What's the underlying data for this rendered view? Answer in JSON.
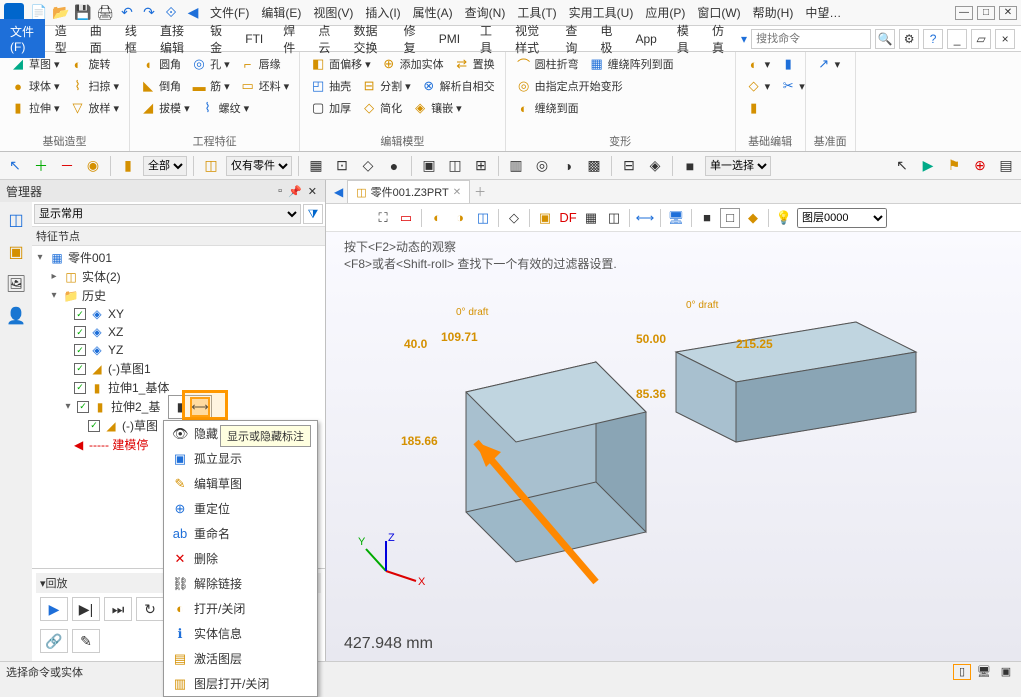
{
  "menus": [
    "文件(F)",
    "编辑(E)",
    "视图(V)",
    "插入(I)",
    "属性(A)",
    "查询(N)",
    "工具(T)",
    "实用工具(U)",
    "应用(P)",
    "窗口(W)",
    "帮助(H)",
    "中望…"
  ],
  "ribbon_tabs": [
    "文件(F)",
    "造型",
    "曲面",
    "线框",
    "直接编辑",
    "钣金",
    "FTI",
    "焊件",
    "点云",
    "数据交换",
    "修复",
    "PMI",
    "工具",
    "视觉样式",
    "查询",
    "电极",
    "App",
    "模具",
    "仿真"
  ],
  "active_tab": "文件(F)",
  "search_placeholder": "搜找命令",
  "ribbon": {
    "group1_label": "基础造型",
    "group1_btns": [
      "草图",
      "旋转",
      "球体",
      "扫掠",
      "拉伸",
      "放样"
    ],
    "group2_label": "工程特征",
    "group2_btns": [
      "圆角",
      "孔",
      "唇缘",
      "倒角",
      "筋",
      "坯料",
      "拔模",
      "螺纹"
    ],
    "group3_label": "编辑模型",
    "group3_btns": [
      "面偏移",
      "添加实体",
      "置换",
      "抽壳",
      "分割",
      "解析自相交",
      "加厚",
      "简化",
      "镶嵌"
    ],
    "group4_label": "变形",
    "group4_btns": [
      "圆柱折弯",
      "缠绕阵列到面",
      "由指定点开始变形",
      "缠绕到面"
    ],
    "group5_label": "基础编辑",
    "group6_label": "基准面"
  },
  "toolbar2": {
    "filter1": "全部",
    "filter2": "仅有零件",
    "filter3": "单一选择"
  },
  "manager": {
    "title": "管理器",
    "display_mode": "显示常用",
    "tree_header": "特征节点",
    "root": "零件001",
    "nodes": {
      "shiti": "实体(2)",
      "history": "历史",
      "xy": "XY",
      "xz": "XZ",
      "yz": "YZ",
      "sketch1": "(-)草图1",
      "extrude1": "拉伸1_基体",
      "extrude2": "拉伸2_基",
      "sketch2": "(-)草图",
      "modelstop": "----- 建模停"
    },
    "playback": "回放"
  },
  "context_menu": {
    "items": [
      "隐藏",
      "孤立显示",
      "编辑草图",
      "重定位",
      "重命名",
      "删除",
      "解除链接",
      "打开/关闭",
      "实体信息",
      "激活图层",
      "图层打开/关闭"
    ],
    "tooltip": "显示或隐藏标注"
  },
  "viewport": {
    "tab": "零件001.Z3PRT",
    "layer": "图层0000",
    "hint1": "按下<F2>动态的观察",
    "hint2": "<F8>或者<Shift-roll> 查找下一个有效的过滤器设置.",
    "coord": "427.948 mm",
    "dims": {
      "d1": "109.71",
      "d2": "40.0",
      "d3": "185.66",
      "d4": "215.25",
      "d5": "50.00",
      "d6": "85.36",
      "draft1": "0° draft",
      "draft2": "0° draft"
    }
  },
  "statusbar": {
    "text": "选择命令或实体"
  },
  "colors": {
    "accent": "#1e6fd9",
    "dim": "#d49000",
    "highlight": "#ff9800"
  }
}
